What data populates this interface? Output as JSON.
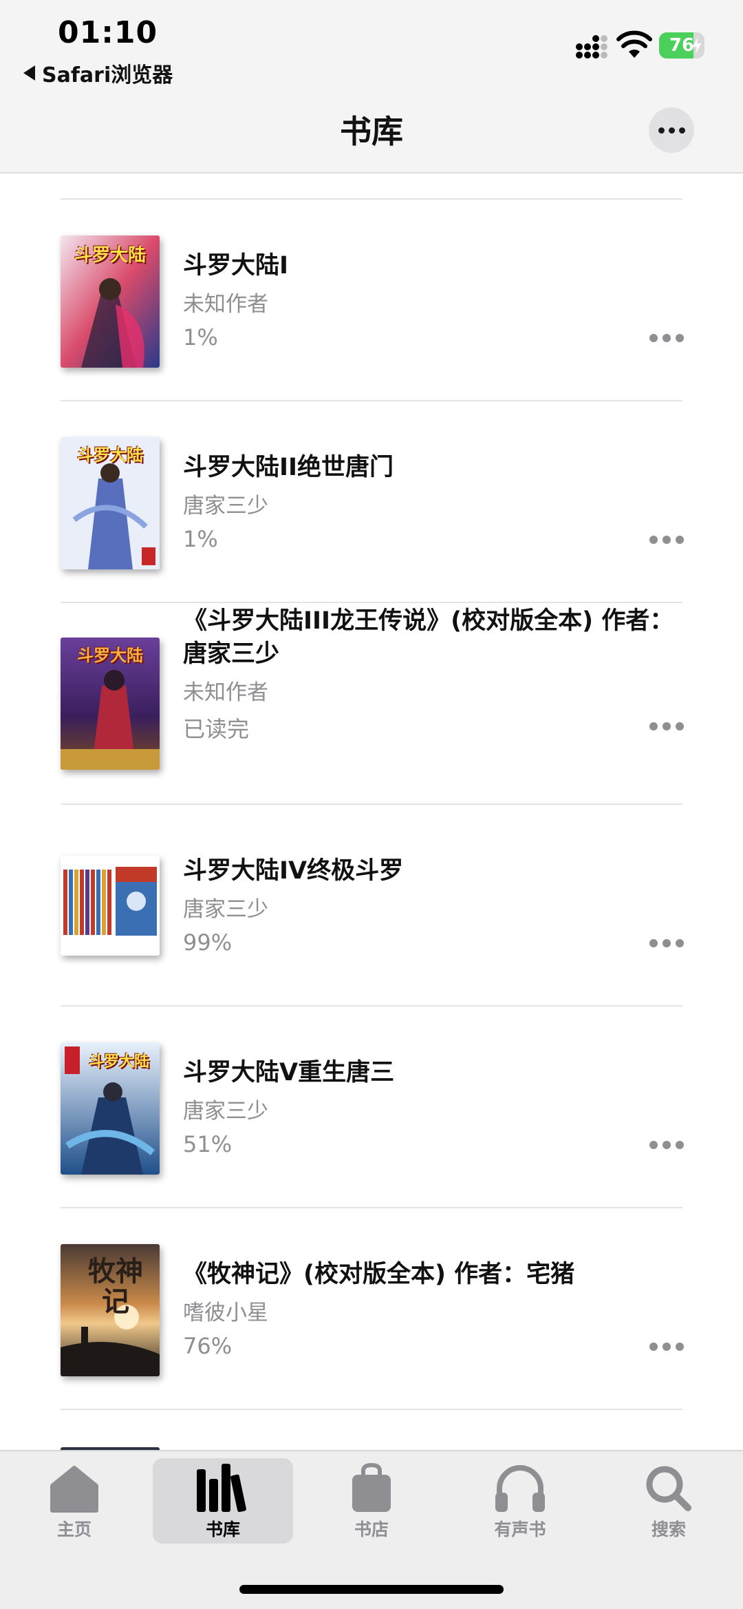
{
  "status": {
    "time": "01:10",
    "back_app": "Safari浏览器",
    "battery": "76",
    "battery_level_percent": 76
  },
  "nav": {
    "title": "书库",
    "more_icon": "ellipsis-icon"
  },
  "books": [
    {
      "title": "斗罗大陆I",
      "author": "未知作者",
      "progress": "1%",
      "cover_colors": [
        "#d94b6a",
        "#2a3a8a",
        "#f3e6ef"
      ]
    },
    {
      "title": "斗罗大陆II绝世唐门",
      "author": "唐家三少",
      "progress": "1%",
      "cover_colors": [
        "#e9eef8",
        "#3d58b3",
        "#c62828"
      ]
    },
    {
      "title_line1": "《斗罗大陆III龙王传说》(校对版全本) 作者：",
      "title_line2": "唐家三少",
      "author": "未知作者",
      "progress": "已读完",
      "cover_colors": [
        "#3a1f5c",
        "#b0283a",
        "#c89a3a"
      ]
    },
    {
      "title": "斗罗大陆IV终极斗罗",
      "author": "唐家三少",
      "progress": "99%",
      "cover_colors": [
        "#ffffff",
        "#c23b2a",
        "#3a6fb3"
      ]
    },
    {
      "title": "斗罗大陆V重生唐三",
      "author": "唐家三少",
      "progress": "51%",
      "cover_colors": [
        "#e8f1fb",
        "#1f4f8a",
        "#c8202a"
      ]
    },
    {
      "title": "《牧神记》(校对版全本) 作者：宅猪",
      "author": "嗜彼小星",
      "progress": "76%",
      "cover_colors": [
        "#2a2320",
        "#c98a4a",
        "#f0c88a"
      ]
    }
  ],
  "row_more_icon": "ellipsis-icon",
  "tabs": [
    {
      "label": "主页",
      "icon": "house-icon",
      "active": false
    },
    {
      "label": "书库",
      "icon": "library-books-icon",
      "active": true
    },
    {
      "label": "书店",
      "icon": "shopping-bag-icon",
      "active": false
    },
    {
      "label": "有声书",
      "icon": "headphones-icon",
      "active": false
    },
    {
      "label": "搜索",
      "icon": "search-icon",
      "active": false
    }
  ]
}
